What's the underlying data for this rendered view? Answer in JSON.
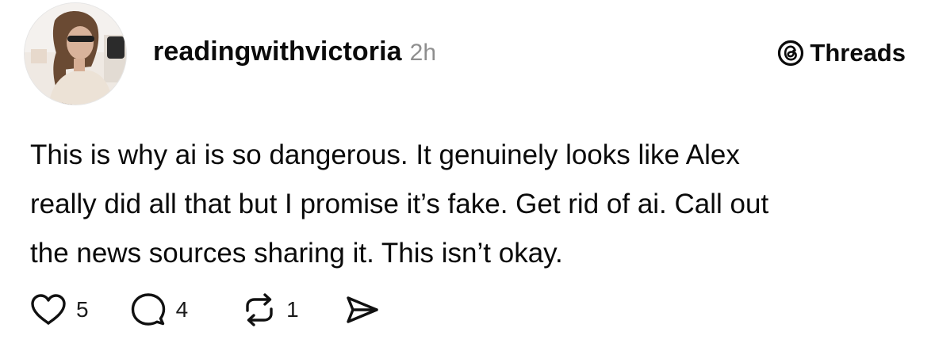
{
  "post": {
    "author": "readingwithvictoria",
    "time": "2h",
    "avatar": "profile-photo",
    "brand": {
      "icon": "threads-logo-icon",
      "label": "Threads"
    },
    "text_lines": [
      "This is why ai is so dangerous. It genuinely looks like Alex",
      "really did all that but I promise it’s fake. Get rid of ai. Call out",
      "the news sources sharing it. This isn’t okay."
    ],
    "actions": {
      "likes": {
        "icon": "heart-icon",
        "count": "5"
      },
      "replies": {
        "icon": "comment-icon",
        "count": "4"
      },
      "reposts": {
        "icon": "repost-icon",
        "count": "1"
      },
      "share": {
        "icon": "send-icon"
      }
    }
  }
}
